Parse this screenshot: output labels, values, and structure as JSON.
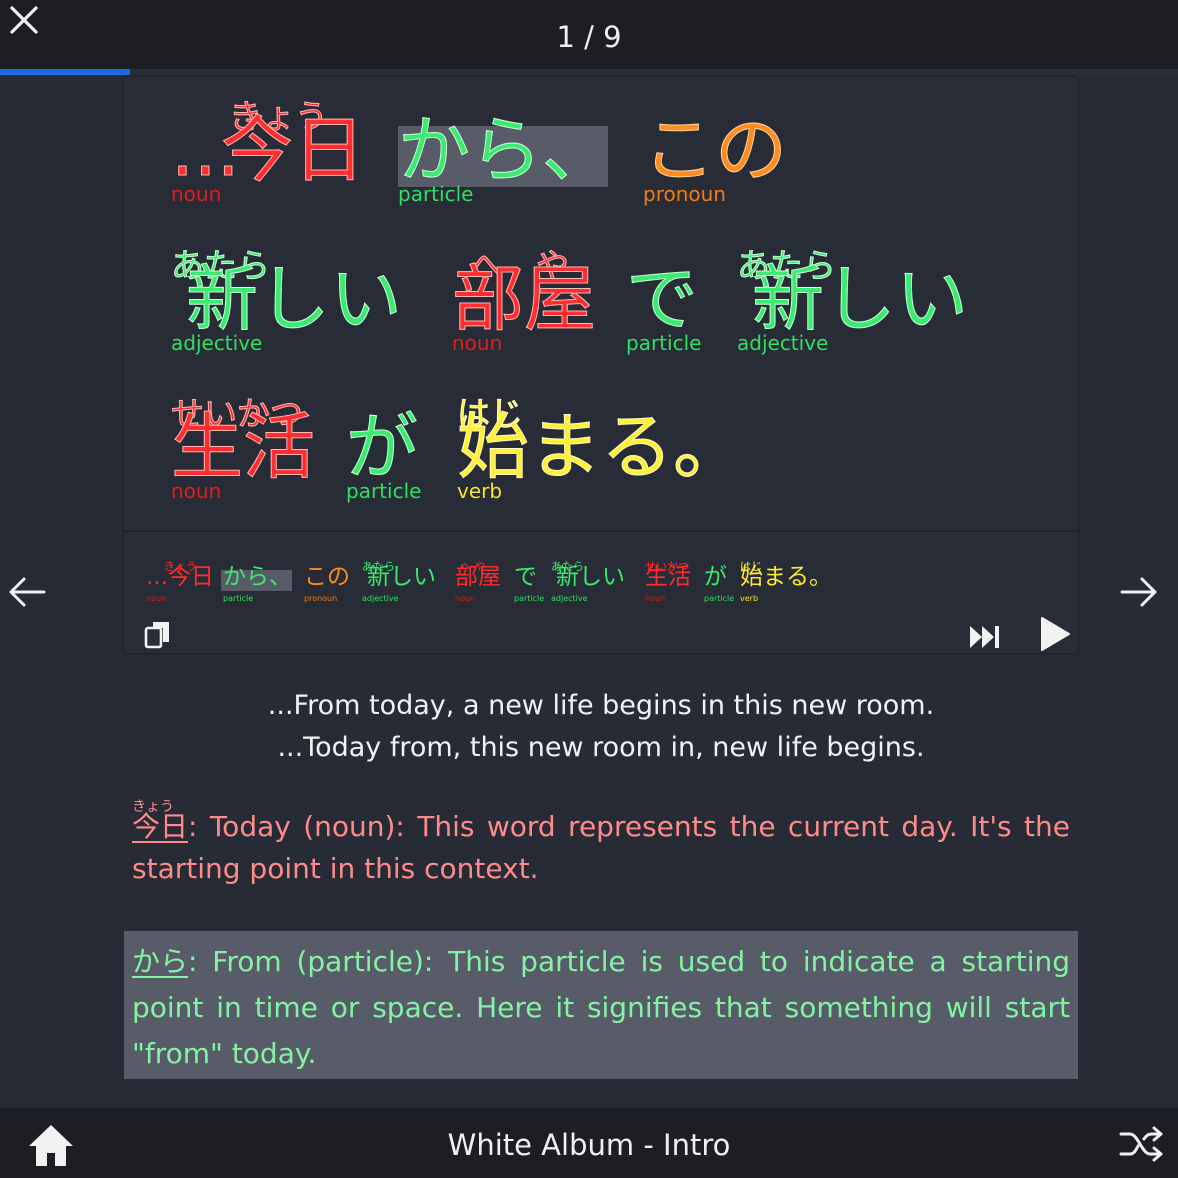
{
  "header": {
    "counter": "1 / 9",
    "progress_fraction": 0.11
  },
  "sentence_big": {
    "rows": [
      [
        {
          "prefix": "...",
          "kanji": "今日",
          "ruby": "きょう",
          "pos": "noun",
          "color": "red"
        },
        {
          "kanji": "から、",
          "ruby": "",
          "pos": "particle",
          "color": "green",
          "highlighted": true
        },
        {
          "kanji": "この",
          "ruby": "",
          "pos": "pronoun",
          "color": "orange"
        }
      ],
      [
        {
          "kanji": "新しい",
          "ruby": "あたら",
          "pos": "adjective",
          "color": "green"
        },
        {
          "kanji": "部屋",
          "ruby": "へ　や",
          "pos": "noun",
          "color": "red"
        },
        {
          "kanji": "で",
          "ruby": "",
          "pos": "particle",
          "color": "green"
        },
        {
          "kanji": "新しい",
          "ruby": "あたら",
          "pos": "adjective",
          "color": "green"
        }
      ],
      [
        {
          "kanji": "生活",
          "ruby": "せいかつ",
          "pos": "noun",
          "color": "red"
        },
        {
          "kanji": "が",
          "ruby": "",
          "pos": "particle",
          "color": "green"
        },
        {
          "kanji": "始まる。",
          "ruby": "はじ",
          "pos": "verb",
          "color": "yellow"
        }
      ]
    ]
  },
  "sentence_small": [
    {
      "kanji": "...今日",
      "ruby": "きょう",
      "pos": "noun",
      "color": "red"
    },
    {
      "kanji": "から、",
      "ruby": "",
      "pos": "particle",
      "color": "green",
      "highlighted": true
    },
    {
      "kanji": "この",
      "ruby": "",
      "pos": "pronoun",
      "color": "orange"
    },
    {
      "kanji": "新しい",
      "ruby": "あたら",
      "pos": "adjective",
      "color": "green"
    },
    {
      "kanji": "部屋",
      "ruby": "へ や",
      "pos": "noun",
      "color": "red"
    },
    {
      "kanji": "で",
      "ruby": "",
      "pos": "particle",
      "color": "green"
    },
    {
      "kanji": "新しい",
      "ruby": "あたら",
      "pos": "adjective",
      "color": "green"
    },
    {
      "kanji": "生活",
      "ruby": "せいかつ",
      "pos": "noun",
      "color": "red"
    },
    {
      "kanji": "が",
      "ruby": "",
      "pos": "particle",
      "color": "green"
    },
    {
      "kanji": "始まる。",
      "ruby": "はじ",
      "pos": "verb",
      "color": "yellow"
    }
  ],
  "controls": {
    "copy_icon": "copy-icon",
    "skip_icon": "skip-forward-icon",
    "play_icon": "play-icon",
    "prev_icon": "arrow-left-icon",
    "next_icon": "arrow-right-icon"
  },
  "translations": {
    "natural": "...From today, a new life begins in this new room.",
    "literal": "...Today from, this new room in, new life begins."
  },
  "explanations": [
    {
      "word": "今日",
      "ruby": "きょう",
      "text": ": Today (noun): This word represents the current day. It's the starting point in this context.",
      "color": "#ff8a8a"
    },
    {
      "word": "から",
      "ruby": "",
      "text": ": From (particle): This particle is used to indicate a starting point in time or space. Here it signifies that something will start \"from\" today.",
      "color": "#84f2a4",
      "highlighted": true
    }
  ],
  "footer": {
    "album_title": "White Album - Intro",
    "home_icon": "home-icon",
    "shuffle_icon": "shuffle-icon"
  },
  "colors": {
    "noun": "#ff2d2d",
    "particle": "#3cea71",
    "pronoun": "#ff8d1e",
    "adjective": "#3cea71",
    "verb": "#fff034",
    "accent": "#1a6fe0",
    "background": "#272b36"
  }
}
